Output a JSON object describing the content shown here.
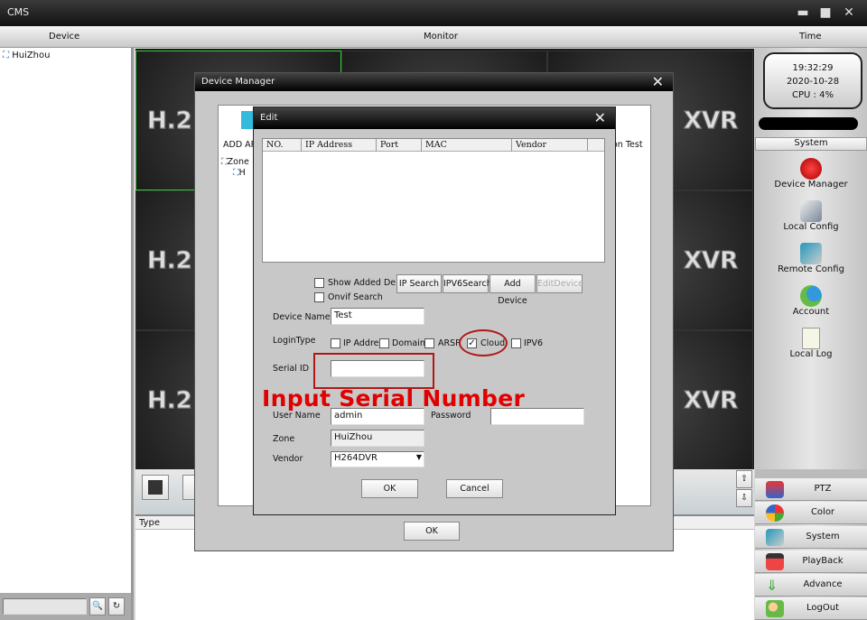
{
  "window": {
    "title": "CMS",
    "minimize": "▬",
    "maximize": "■",
    "close": "✕"
  },
  "header": {
    "device": "Device",
    "monitor": "Monitor",
    "time": "Time"
  },
  "device_tree": {
    "root": "HuiZhou"
  },
  "monitor": {
    "logo_left": "H.2",
    "logo_right": "XVR"
  },
  "list": {
    "type_header": "Type"
  },
  "clock": {
    "time": "19:32:29",
    "date": "2020-10-28",
    "cpu": "CPU : 4%"
  },
  "system_panel": {
    "header": "System",
    "items": [
      {
        "label": "Device Manager",
        "icon": "device-manager-icon"
      },
      {
        "label": "Local Config",
        "icon": "local-config-icon"
      },
      {
        "label": "Remote Config",
        "icon": "remote-config-icon"
      },
      {
        "label": "Account",
        "icon": "account-icon"
      },
      {
        "label": "Local Log",
        "icon": "local-log-icon"
      }
    ]
  },
  "menu": [
    {
      "label": "PTZ"
    },
    {
      "label": "Color"
    },
    {
      "label": "System"
    },
    {
      "label": "PlayBack"
    },
    {
      "label": "Advance"
    },
    {
      "label": "LogOut"
    }
  ],
  "device_manager": {
    "title": "Device Manager",
    "close": "✕",
    "add_area": "ADD AR",
    "conn_test": "on Test",
    "tree_zone": "Zone",
    "tree_child": "H",
    "ok": "OK"
  },
  "edit": {
    "title": "Edit",
    "close": "✕",
    "columns": [
      "NO.",
      "IP Address",
      "Port",
      "MAC",
      "Vendor"
    ],
    "show_added": "Show Added Devic",
    "onvif": "Onvif Search",
    "buttons": {
      "ip_search": "IP Search",
      "ipv6_search": "IPV6Search",
      "add_device": "Add Device",
      "edit_device": "EditDevice"
    },
    "device_name_label": "Device Name",
    "device_name": "Test",
    "login_type_label": "LoginType",
    "login_types": [
      {
        "label": "IP Addres",
        "checked": false
      },
      {
        "label": "Domain",
        "checked": false
      },
      {
        "label": "ARSP",
        "checked": false
      },
      {
        "label": "Cloud",
        "checked": true
      },
      {
        "label": "IPV6",
        "checked": false
      }
    ],
    "serial_label": "Serial ID",
    "serial": "",
    "user_label": "User Name",
    "user": "admin",
    "password_label": "Password",
    "password": "",
    "zone_label": "Zone",
    "zone": "HuiZhou",
    "vendor_label": "Vendor",
    "vendor": "H264DVR",
    "ok": "OK",
    "cancel": "Cancel"
  },
  "annotation": {
    "text": "Input Serial Number",
    "color": "#e00000"
  }
}
